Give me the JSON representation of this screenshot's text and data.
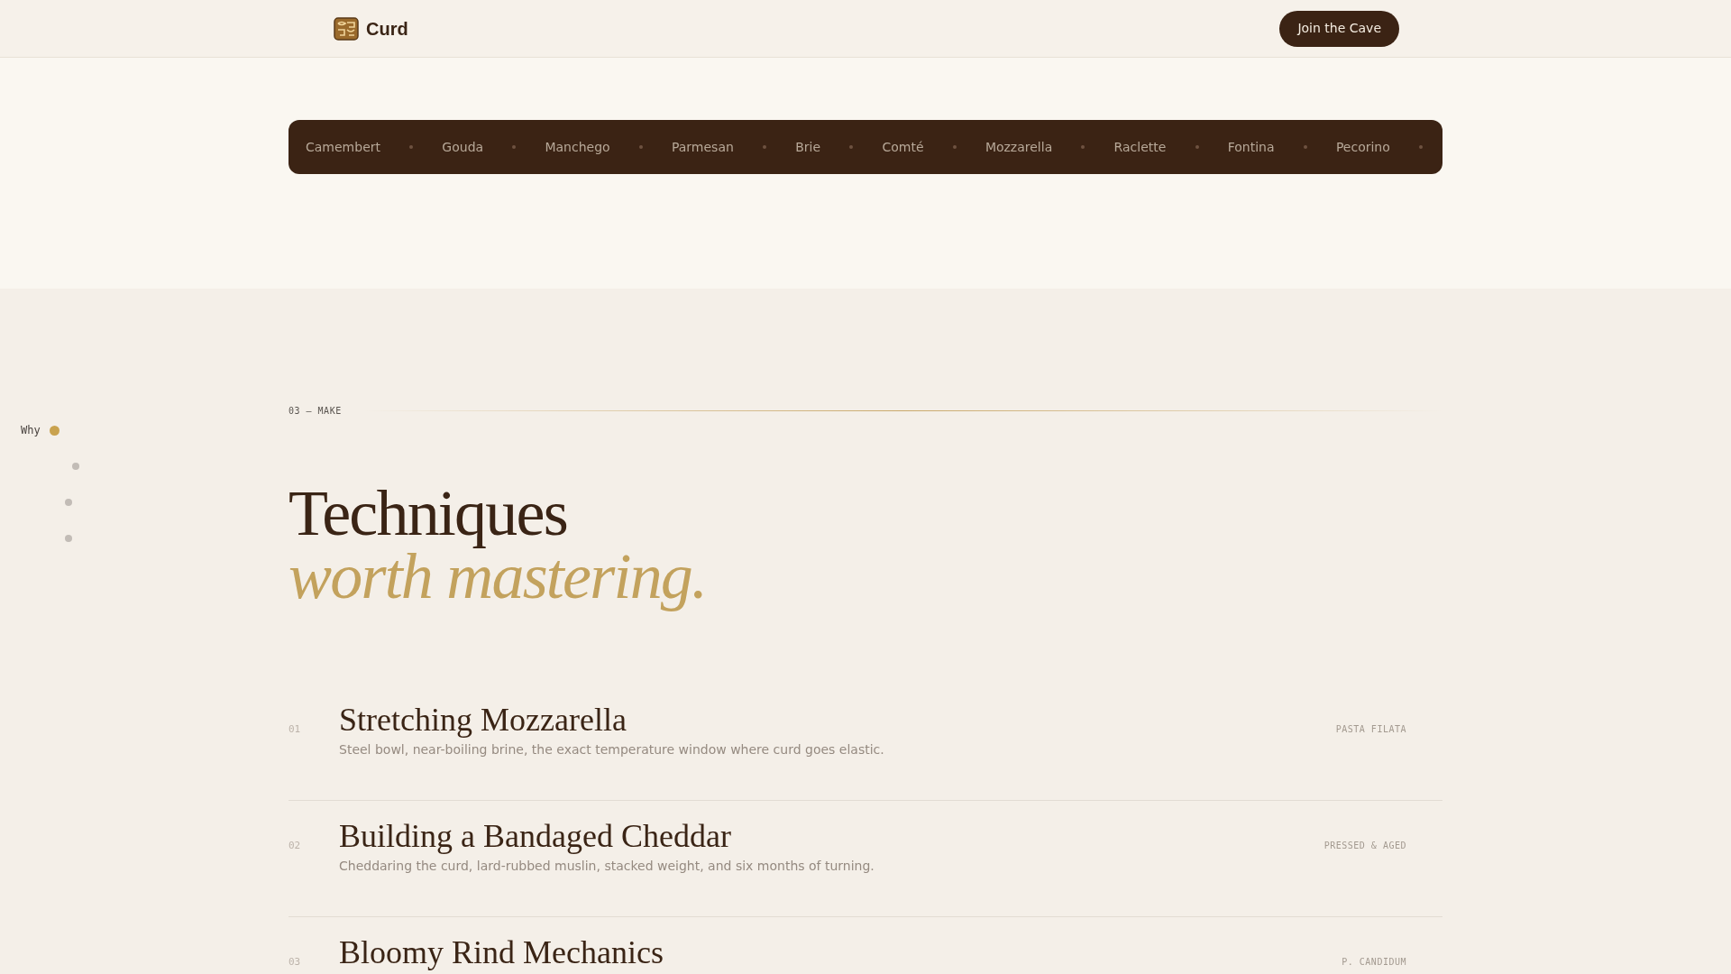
{
  "header": {
    "brand": "Curd",
    "cta": "Join the Cave"
  },
  "ticker": [
    "Camembert",
    "Gouda",
    "Manchego",
    "Parmesan",
    "Brie",
    "Comté",
    "Mozzarella",
    "Raclette",
    "Fontina",
    "Pecorino"
  ],
  "side_nav": [
    {
      "label": "Why",
      "selected": true
    },
    {
      "selected": false
    },
    {
      "selected": false
    },
    {
      "selected": false
    }
  ],
  "section": {
    "eyebrow": "03 — MAKE",
    "title": "Techniques",
    "subtitle": "worth mastering."
  },
  "techniques": [
    {
      "number": "01",
      "title": "Stretching Mozzarella",
      "description": "Steel bowl, near-boiling brine, the exact temperature window where curd goes elastic.",
      "tag": "PASTA FILATA"
    },
    {
      "number": "02",
      "title": "Building a Bandaged Cheddar",
      "description": "Cheddaring the curd, lard-rubbed muslin, stacked weight, and six months of turning.",
      "tag": "PRESSED & AGED"
    },
    {
      "number": "03",
      "title": "Bloomy Rind Mechanics",
      "tag": "P. CANDIDUM"
    }
  ]
}
